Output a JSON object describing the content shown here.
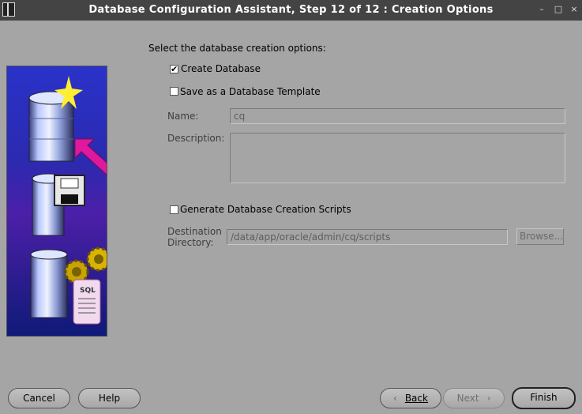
{
  "window": {
    "title": "Database Configuration Assistant, Step 12 of 12 : Creation Options",
    "minimize_glyph": "–",
    "maximize_glyph": "□",
    "close_glyph": "×"
  },
  "form": {
    "heading": "Select the database creation options:",
    "create_database": {
      "label": "Create Database",
      "checked": true
    },
    "save_template": {
      "label": "Save as a Database Template",
      "checked": false
    },
    "name_label": "Name:",
    "name_value": "cq",
    "description_label": "Description:",
    "description_value": "",
    "generate_scripts": {
      "label": "Generate Database Creation Scripts",
      "checked": false
    },
    "destination_label_1": "Destination",
    "destination_label_2": "Directory:",
    "destination_value": "/data/app/oracle/admin/cq/scripts",
    "browse_label": "Browse..."
  },
  "footer": {
    "cancel": "Cancel",
    "help": "Help",
    "back": "Back",
    "next": "Next",
    "finish": "Finish"
  },
  "illustration": {
    "sql_scroll_text": "SQL"
  },
  "colors": {
    "background": "#a5a5a5",
    "titlebar": "#444444",
    "panel_blue": "#2a32c8",
    "arrow_magenta": "#e0189e"
  }
}
